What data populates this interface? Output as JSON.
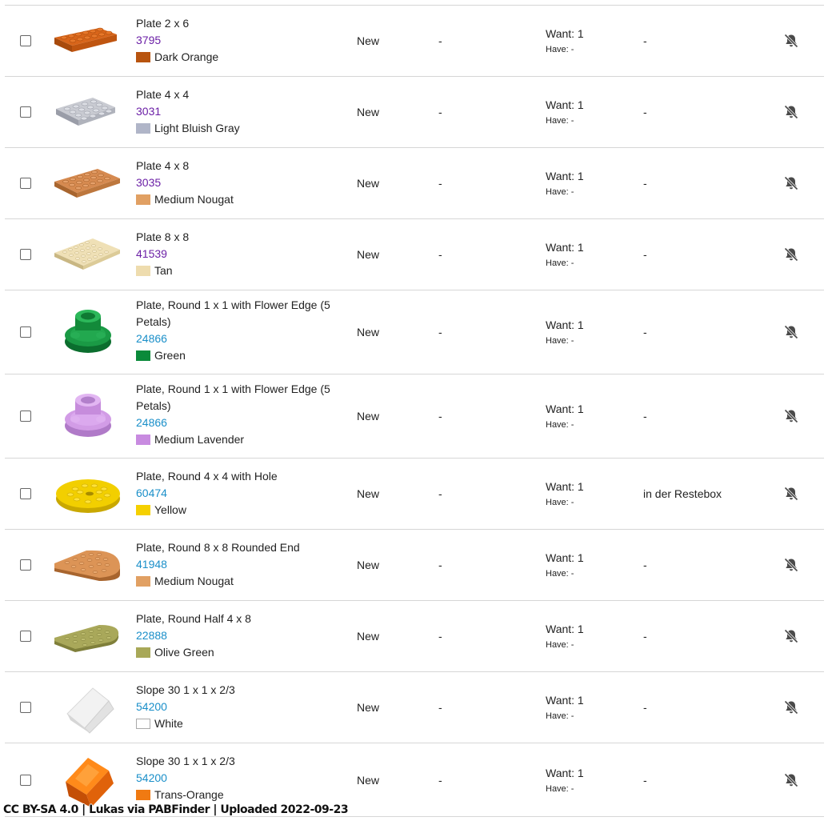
{
  "colors": {
    "purple_link": "#6b1fa6",
    "blue_link": "#1a8fc9",
    "divider": "#d6d6d6"
  },
  "rows": [
    {
      "name": "Plate 2 x 6",
      "number": "3795",
      "color_name": "Dark Orange",
      "swatch": "#b8540f",
      "condition": "New",
      "comment": "-",
      "want": "Want: 1",
      "have": "Have: -",
      "note": "-",
      "icon": "bell-slash-icon"
    },
    {
      "name": "Plate 4 x 4",
      "number": "3031",
      "color_name": "Light Bluish Gray",
      "swatch": "#b0b5c8",
      "condition": "New",
      "comment": "-",
      "want": "Want: 1",
      "have": "Have: -",
      "note": "-",
      "icon": "bell-slash-icon"
    },
    {
      "name": "Plate 4 x 8",
      "number": "3035",
      "color_name": "Medium Nougat",
      "swatch": "#e1a063",
      "condition": "New",
      "comment": "-",
      "want": "Want: 1",
      "have": "Have: -",
      "note": "-",
      "icon": "bell-slash-icon"
    },
    {
      "name": "Plate 8 x 8",
      "number": "41539",
      "color_name": "Tan",
      "swatch": "#eedcae",
      "condition": "New",
      "comment": "-",
      "want": "Want: 1",
      "have": "Have: -",
      "note": "-",
      "icon": "bell-slash-icon"
    },
    {
      "name": "Plate, Round 1 x 1 with Flower Edge (5 Petals)",
      "number": "24866",
      "color_name": "Green",
      "swatch": "#0a8a3a",
      "condition": "New",
      "comment": "-",
      "want": "Want: 1",
      "have": "Have: -",
      "note": "-",
      "icon": "bell-slash-icon"
    },
    {
      "name": "Plate, Round 1 x 1 with Flower Edge (5 Petals)",
      "number": "24866",
      "color_name": "Medium Lavender",
      "swatch": "#c88be0",
      "condition": "New",
      "comment": "-",
      "want": "Want: 1",
      "have": "Have: -",
      "note": "-",
      "icon": "bell-slash-icon"
    },
    {
      "name": "Plate, Round 4 x 4 with Hole",
      "number": "60474",
      "color_name": "Yellow",
      "swatch": "#f5d000",
      "condition": "New",
      "comment": "-",
      "want": "Want: 1",
      "have": "Have: -",
      "note": "in der Restebox",
      "icon": "bell-slash-icon"
    },
    {
      "name": "Plate, Round 8 x 8 Rounded End",
      "number": "41948",
      "color_name": "Medium Nougat",
      "swatch": "#e1a063",
      "condition": "New",
      "comment": "-",
      "want": "Want: 1",
      "have": "Have: -",
      "note": "-",
      "icon": "bell-slash-icon"
    },
    {
      "name": "Plate, Round Half 4 x 8",
      "number": "22888",
      "color_name": "Olive Green",
      "swatch": "#a8a858",
      "condition": "New",
      "comment": "-",
      "want": "Want: 1",
      "have": "Have: -",
      "note": "-",
      "icon": "bell-slash-icon"
    },
    {
      "name": "Slope 30 1 x 1 x 2/3",
      "number": "54200",
      "color_name": "White",
      "swatch": "#ffffff",
      "condition": "New",
      "comment": "-",
      "want": "Want: 1",
      "have": "Have: -",
      "note": "-",
      "icon": "bell-slash-icon"
    },
    {
      "name": "Slope 30 1 x 1 x 2/3",
      "number": "54200",
      "color_name": "Trans-Orange",
      "swatch": "#f07a12",
      "condition": "New",
      "comment": "-",
      "want": "Want: 1",
      "have": "Have: -",
      "note": "-",
      "icon": "bell-slash-icon"
    }
  ],
  "footer": {
    "credit": "CC BY-SA 4.0 | Lukas via PABFinder | Uploaded 2022-09-23"
  }
}
